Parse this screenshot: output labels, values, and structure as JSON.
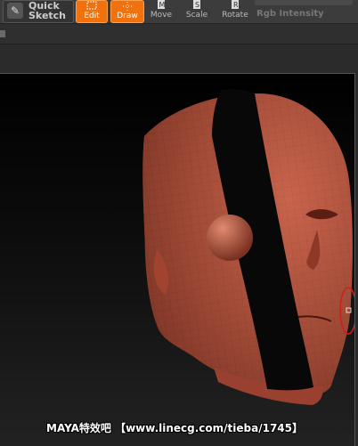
{
  "toolbar": {
    "quick_sketch": {
      "line1": "Quick",
      "line2": "Sketch"
    },
    "tools": [
      {
        "label": "Edit",
        "icon": "edit-icon",
        "active": true
      },
      {
        "label": "Draw",
        "icon": "draw-icon",
        "active": true
      },
      {
        "label": "Move",
        "icon": "move-icon",
        "active": false
      },
      {
        "label": "Scale",
        "icon": "scale-icon",
        "active": false
      },
      {
        "label": "Rotate",
        "icon": "rotate-icon",
        "active": false
      }
    ],
    "rgb_intensity_label": "Rgb Intensity"
  },
  "colors": {
    "accent": "#f0720f",
    "mesh": "#b5523c",
    "background": "#2a2a2a"
  },
  "watermark": "MAYA特效吧  【www.linecg.com/tieba/1745】"
}
